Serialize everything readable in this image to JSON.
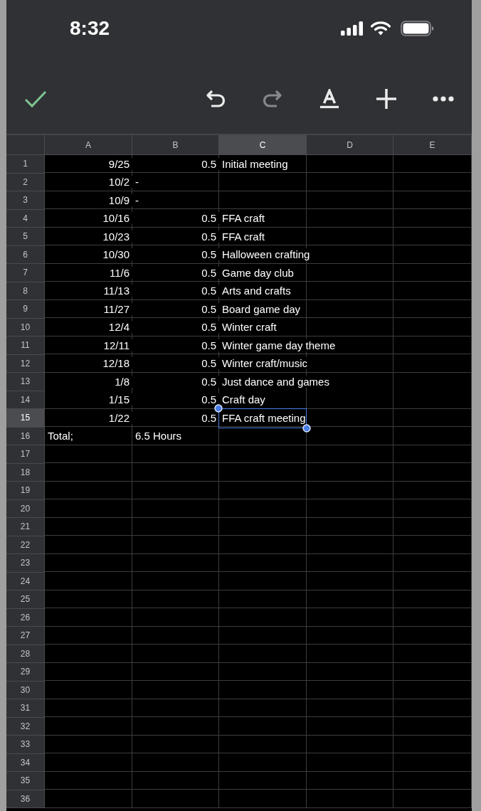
{
  "status_bar": {
    "time": "8:32"
  },
  "toolbar": {
    "buttons": [
      {
        "kind": "done",
        "disabled": false
      },
      {
        "kind": "undo",
        "disabled": false
      },
      {
        "kind": "redo",
        "disabled": true
      },
      {
        "kind": "text-color",
        "disabled": false
      },
      {
        "kind": "insert",
        "disabled": false
      },
      {
        "kind": "more",
        "disabled": false
      }
    ]
  },
  "sheet": {
    "columns": [
      {
        "label": "A",
        "selected": false
      },
      {
        "label": "B",
        "selected": false
      },
      {
        "label": "C",
        "selected": true
      },
      {
        "label": "D",
        "selected": false
      },
      {
        "label": "E",
        "selected": false
      }
    ],
    "rows": [
      {
        "number": "1",
        "selected": false,
        "a": {
          "text": "9/25",
          "kind": "number"
        },
        "b": {
          "text": "0.5",
          "kind": "number"
        },
        "c": {
          "text": "Initial meeting",
          "kind": "text"
        }
      },
      {
        "number": "2",
        "selected": false,
        "a": {
          "text": "10/2",
          "kind": "number"
        },
        "b": {
          "text": "-",
          "kind": "text"
        }
      },
      {
        "number": "3",
        "selected": false,
        "a": {
          "text": "10/9",
          "kind": "number"
        },
        "b": {
          "text": "-",
          "kind": "text"
        }
      },
      {
        "number": "4",
        "selected": false,
        "a": {
          "text": "10/16",
          "kind": "number"
        },
        "b": {
          "text": "0.5",
          "kind": "number"
        },
        "c": {
          "text": "FFA craft",
          "kind": "text"
        }
      },
      {
        "number": "5",
        "selected": false,
        "a": {
          "text": "10/23",
          "kind": "number"
        },
        "b": {
          "text": "0.5",
          "kind": "number"
        },
        "c": {
          "text": "FFA craft",
          "kind": "text"
        }
      },
      {
        "number": "6",
        "selected": false,
        "a": {
          "text": "10/30",
          "kind": "number"
        },
        "b": {
          "text": "0.5",
          "kind": "number"
        },
        "c": {
          "text": "Halloween crafting",
          "kind": "text"
        }
      },
      {
        "number": "7",
        "selected": false,
        "a": {
          "text": "11/6",
          "kind": "number"
        },
        "b": {
          "text": "0.5",
          "kind": "number"
        },
        "c": {
          "text": "Game day club",
          "kind": "text"
        }
      },
      {
        "number": "8",
        "selected": false,
        "a": {
          "text": "11/13",
          "kind": "number"
        },
        "b": {
          "text": "0.5",
          "kind": "number"
        },
        "c": {
          "text": "Arts and crafts",
          "kind": "text"
        }
      },
      {
        "number": "9",
        "selected": false,
        "a": {
          "text": "11/27",
          "kind": "number"
        },
        "b": {
          "text": "0.5",
          "kind": "number"
        },
        "c": {
          "text": "Board game day",
          "kind": "text"
        }
      },
      {
        "number": "10",
        "selected": false,
        "a": {
          "text": "12/4",
          "kind": "number"
        },
        "b": {
          "text": "0.5",
          "kind": "number"
        },
        "c": {
          "text": "Winter craft",
          "kind": "text"
        }
      },
      {
        "number": "11",
        "selected": false,
        "a": {
          "text": "12/11",
          "kind": "number"
        },
        "b": {
          "text": "0.5",
          "kind": "number"
        },
        "c": {
          "text": "Winter game day theme",
          "kind": "text"
        }
      },
      {
        "number": "12",
        "selected": false,
        "a": {
          "text": "12/18",
          "kind": "number"
        },
        "b": {
          "text": "0.5",
          "kind": "number"
        },
        "c": {
          "text": "Winter craft/music",
          "kind": "text"
        }
      },
      {
        "number": "13",
        "selected": false,
        "a": {
          "text": "1/8",
          "kind": "number"
        },
        "b": {
          "text": "0.5",
          "kind": "number"
        },
        "c": {
          "text": "Just dance and games",
          "kind": "text"
        }
      },
      {
        "number": "14",
        "selected": false,
        "a": {
          "text": "1/15",
          "kind": "number"
        },
        "b": {
          "text": "0.5",
          "kind": "number"
        },
        "c": {
          "text": "Craft day",
          "kind": "text"
        }
      },
      {
        "number": "15",
        "selected": true,
        "a": {
          "text": "1/22",
          "kind": "number"
        },
        "b": {
          "text": "0.5",
          "kind": "number"
        },
        "c": {
          "text": "FFA craft meeting",
          "kind": "text"
        }
      },
      {
        "number": "16",
        "selected": false,
        "a": {
          "text": "Total;",
          "kind": "text"
        },
        "b": {
          "text": "6.5 Hours",
          "kind": "text"
        }
      },
      {
        "number": "17",
        "selected": false
      },
      {
        "number": "18",
        "selected": false
      },
      {
        "number": "19",
        "selected": false
      },
      {
        "number": "20",
        "selected": false
      },
      {
        "number": "21",
        "selected": false
      },
      {
        "number": "22",
        "selected": false
      },
      {
        "number": "23",
        "selected": false
      },
      {
        "number": "24",
        "selected": false
      },
      {
        "number": "25",
        "selected": false
      },
      {
        "number": "26",
        "selected": false
      },
      {
        "number": "27",
        "selected": false
      },
      {
        "number": "28",
        "selected": false
      },
      {
        "number": "29",
        "selected": false
      },
      {
        "number": "30",
        "selected": false
      },
      {
        "number": "31",
        "selected": false
      },
      {
        "number": "32",
        "selected": false
      },
      {
        "number": "33",
        "selected": false
      },
      {
        "number": "34",
        "selected": false
      },
      {
        "number": "35",
        "selected": false
      },
      {
        "number": "36",
        "selected": false
      }
    ]
  }
}
